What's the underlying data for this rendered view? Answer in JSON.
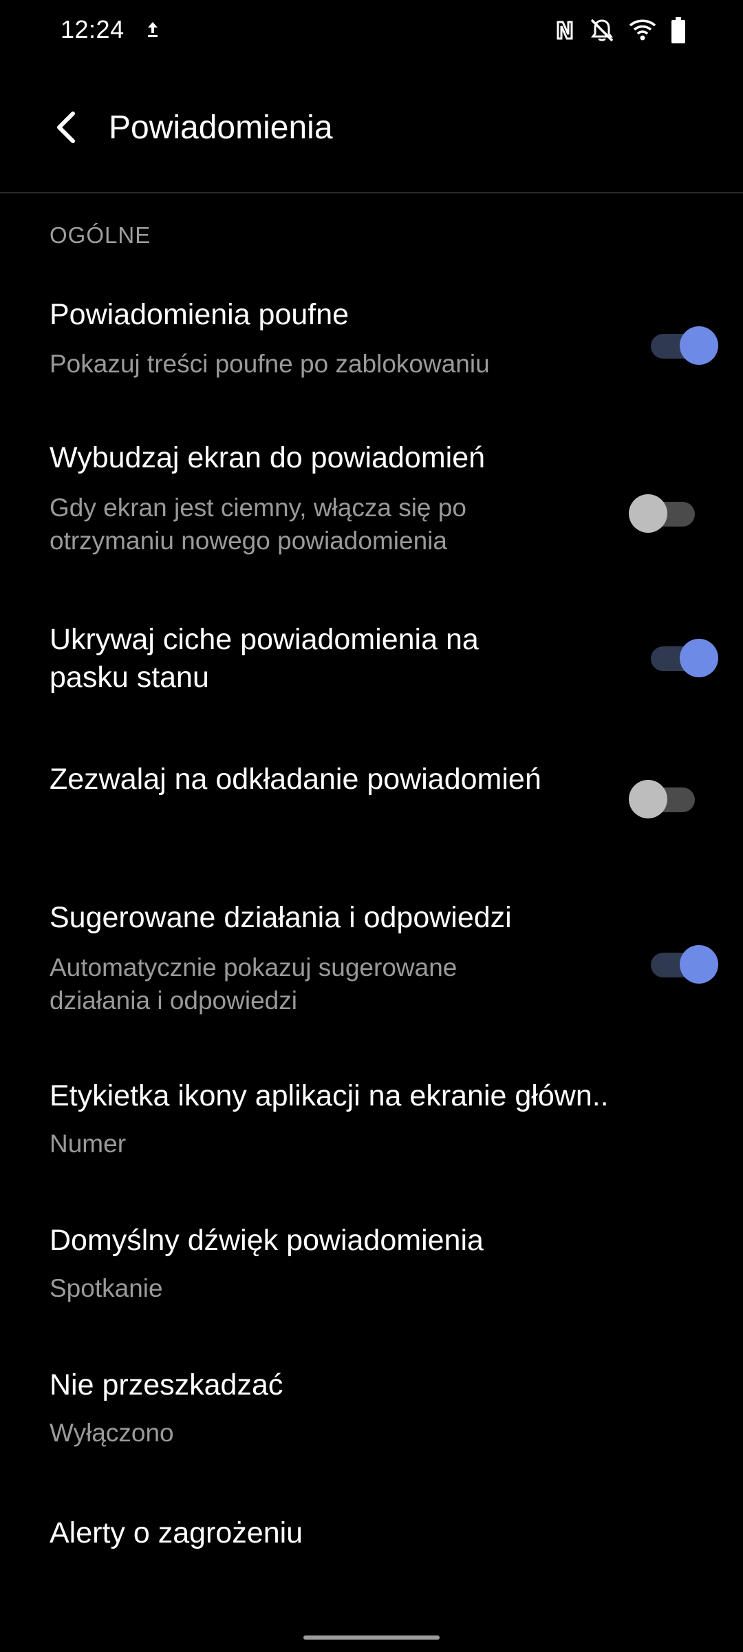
{
  "status_bar": {
    "time": "12:24",
    "icons": [
      "upload-icon",
      "nfc-icon",
      "bell-off-icon",
      "wifi-icon",
      "battery-icon"
    ]
  },
  "app_bar": {
    "back_icon": "back-arrow-icon",
    "title": "Powiadomienia"
  },
  "section": {
    "header": "OGÓLNE"
  },
  "preferences": [
    {
      "title": "Powiadomienia poufne",
      "summary": "Pokazuj treści poufne po zablokowaniu",
      "switch": "on"
    },
    {
      "title": "Wybudzaj ekran do powiadomień",
      "summary": "Gdy ekran jest ciemny, włącza się po otrzymaniu nowego powiadomienia",
      "switch": "off"
    },
    {
      "title": "Ukrywaj ciche powiadomienia na pasku stanu",
      "switch": "on"
    },
    {
      "title": "Zezwalaj na odkładanie powiadomień",
      "switch": "off"
    },
    {
      "title": "Sugerowane działania i odpowiedzi",
      "summary": "Automatycznie pokazuj sugerowane działania i odpowiedzi",
      "switch": "on"
    },
    {
      "title": "Etykietka ikony aplikacji na ekranie główn..",
      "summary": "Numer"
    },
    {
      "title": "Domyślny dźwięk powiadomienia",
      "summary": "Spotkanie"
    },
    {
      "title": "Nie przeszkadzać",
      "summary": "Wyłączono"
    },
    {
      "title": "Alerty o zagrożeniu"
    }
  ],
  "colors": {
    "background": "#000000",
    "switch_on_thumb": "#6d8ae6",
    "switch_on_track": "#2f3950",
    "switch_off_thumb": "#bdbdbd",
    "switch_off_track": "#4b4b4b",
    "summary_text": "#9a9a9a"
  }
}
